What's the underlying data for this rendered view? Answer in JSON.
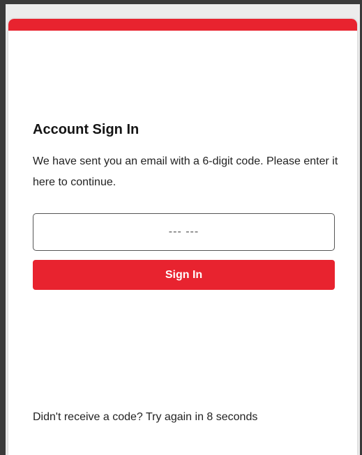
{
  "colors": {
    "accent": "#e8232f",
    "background": "#ececec",
    "card": "#ffffff"
  },
  "signin": {
    "title": "Account Sign In",
    "description": "We have sent you an email with a 6-digit code. Please enter it here to continue.",
    "code_placeholder": "--- ---",
    "code_value": "",
    "button_label": "Sign In",
    "resend_text": "Didn't receive a code? Try again in 8 seconds"
  }
}
